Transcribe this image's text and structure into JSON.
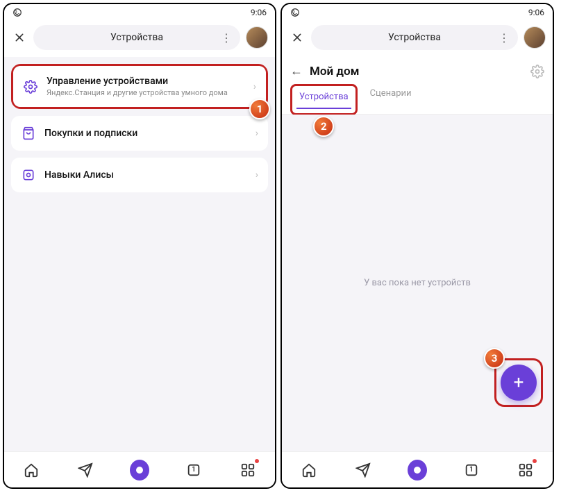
{
  "status": {
    "time": "9:06"
  },
  "header": {
    "title": "Устройства"
  },
  "screen1": {
    "cards": [
      {
        "title": "Управление устройствами",
        "subtitle": "Яндекс.Станция и другие устройства умного дома"
      },
      {
        "title": "Покупки и подписки"
      },
      {
        "title": "Навыки Алисы"
      }
    ]
  },
  "screen2": {
    "title": "Мой дом",
    "tabs": {
      "devices": "Устройства",
      "scenarios": "Сценарии"
    },
    "empty": "У вас пока нет устройств"
  },
  "badges": {
    "one": "1",
    "two": "2",
    "three": "3"
  },
  "nav": {
    "tab_count": "1"
  }
}
